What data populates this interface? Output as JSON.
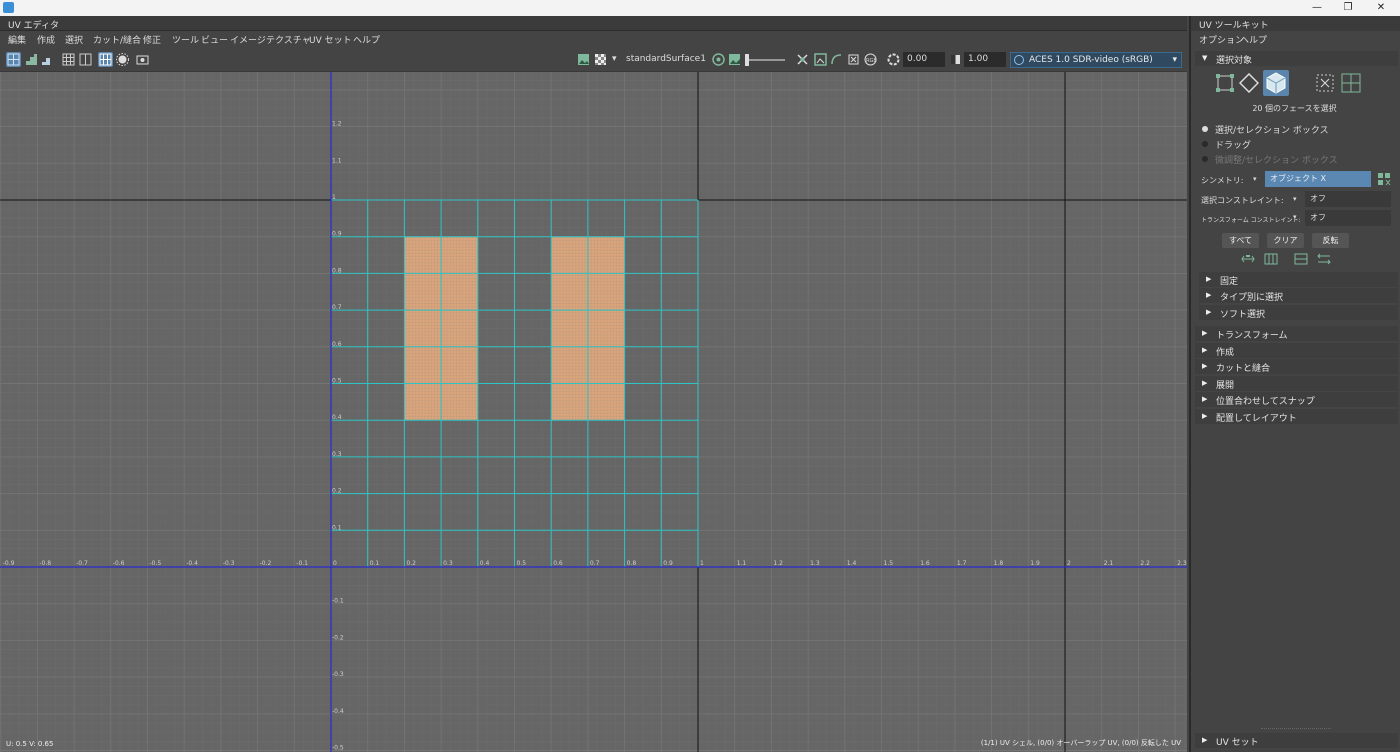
{
  "titlebar": {
    "minimize": "—",
    "restore": "❐",
    "close": "✕"
  },
  "editor": {
    "title": "UV エディタ",
    "menu": [
      "編集",
      "作成",
      "選択",
      "カット/縫合",
      "修正",
      "ツール",
      "ビュー",
      "イメージ",
      "テクスチャ",
      "UV セット",
      "ヘルプ"
    ],
    "toolbar": {
      "shader_name": "standardSurface1",
      "exposure": "0.00",
      "gamma": "1.00",
      "color_space": "ACES 1.0 SDR-video (sRGB)"
    },
    "grid": {
      "u_labels": [
        "-0.9",
        "-0.8",
        "-0.7",
        "-0.6",
        "-0.5",
        "-0.4",
        "-0.3",
        "-0.2",
        "-0.1",
        "0",
        "0.1",
        "0.2",
        "0.3",
        "0.4",
        "0.5",
        "0.6",
        "0.7",
        "0.8",
        "0.9",
        "1",
        "1.1",
        "1.2",
        "1.3",
        "1.4",
        "1.5",
        "1.6",
        "1.7",
        "1.8",
        "1.9",
        "2",
        "2.1",
        "2.2",
        "2.3"
      ],
      "v_labels": [
        "1.2",
        "1.1",
        "1",
        "0.9",
        "0.8",
        "0.7",
        "0.6",
        "0.5",
        "0.4",
        "0.3",
        "0.2",
        "0.1",
        "-0.1",
        "-0.2",
        "-0.3",
        "-0.4",
        "-0.5"
      ],
      "selected_shells": [
        {
          "u0": 0.2,
          "u1": 0.4,
          "v0": 0.4,
          "v1": 0.9
        },
        {
          "u0": 0.6,
          "u1": 0.8,
          "v0": 0.4,
          "v1": 0.9
        }
      ],
      "colors": {
        "background": "#666666",
        "uv_line": "#2ec4c4",
        "selected": "#e8a878",
        "axis": "#2a2acc"
      }
    },
    "status_left": "U: 0.5 V: 0.65",
    "status_right": "(1/1) UV シェル, (0/0) オーバーラップ UV, (0/0) 反転した UV"
  },
  "toolkit": {
    "title": "UV ツールキット",
    "menu": [
      "オプション",
      "ヘルプ"
    ],
    "selection": {
      "header": "選択対象",
      "count_text": "20 個のフェースを選択",
      "radios": [
        "選択/セレクション ボックス",
        "ドラッグ",
        "微調整/セレクション ボックス"
      ],
      "symmetry_label": "シンメトリ:",
      "symmetry_value": "オブジェクト X",
      "constraint_label": "選択コンストレイント:",
      "constraint_value": "オフ",
      "transform_constraint_label": "トランスフォーム コンストレイント:",
      "transform_constraint_value": "オフ",
      "buttons": [
        "すべて",
        "クリア",
        "反転"
      ]
    },
    "sub_sections": [
      "固定",
      "タイプ別に選択",
      "ソフト選択"
    ],
    "sections": [
      "トランスフォーム",
      "作成",
      "カットと縫合",
      "展開",
      "位置合わせしてスナップ",
      "配置してレイアウト"
    ],
    "bottom_section": "UV セット"
  }
}
